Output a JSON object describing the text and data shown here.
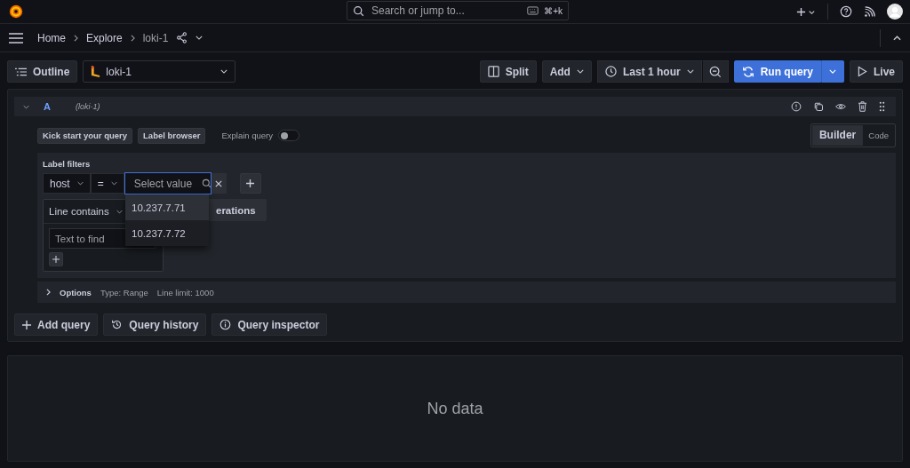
{
  "topbar": {
    "search": {
      "placeholder": "Search or jump to...",
      "shortcut": "⌘+k"
    }
  },
  "breadcrumbs": [
    {
      "label": "Home",
      "current": false
    },
    {
      "label": "Explore",
      "current": false
    },
    {
      "label": "loki-1",
      "current": true
    }
  ],
  "toolbar": {
    "outline": "Outline",
    "datasource": "loki-1",
    "split": "Split",
    "add": "Add",
    "time_range": "Last 1 hour",
    "run_query": "Run query",
    "live": "Live"
  },
  "query": {
    "ref": "A",
    "datasource": "(loki-1)",
    "buttons": [
      "Kick start your query",
      "Label browser"
    ],
    "explain": {
      "label": "Explain query",
      "on": false
    },
    "modes": [
      {
        "label": "Builder",
        "selected": true
      },
      {
        "label": "Code",
        "selected": false
      }
    ],
    "label_filters_title": "Label filters",
    "filter": {
      "label": "host",
      "operator": "=",
      "value_placeholder": "Select value"
    },
    "value_options": [
      {
        "label": "10.237.7.71",
        "selected": true
      },
      {
        "label": "10.237.7.72",
        "selected": false
      }
    ],
    "line_filter": {
      "label": "Line contains",
      "placeholder": "Text to find"
    },
    "operations_button": "erations",
    "options": {
      "title": "Options",
      "type": "Type: Range",
      "line_limit": "Line limit: 1000"
    }
  },
  "actions": [
    "Add query",
    "Query history",
    "Query inspector"
  ],
  "result": {
    "message": "No data"
  }
}
